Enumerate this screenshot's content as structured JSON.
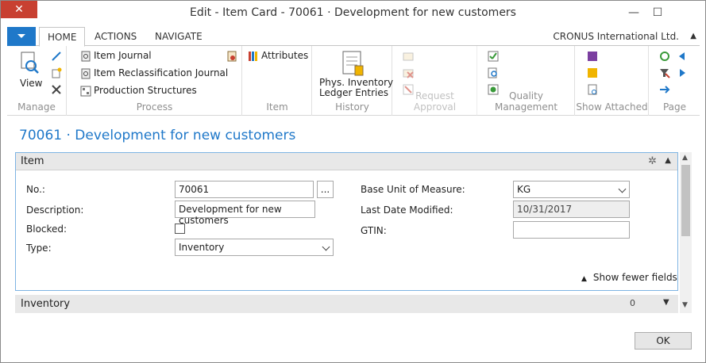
{
  "window": {
    "title": "Edit - Item Card - 70061 · Development for new customers",
    "minimize": "—",
    "maximize": "☐",
    "close": "✕"
  },
  "tabs": {
    "home": "HOME",
    "actions": "ACTIONS",
    "navigate": "NAVIGATE"
  },
  "company": "CRONUS International Ltd.",
  "ribbon": {
    "manage": {
      "label": "Manage",
      "view": "View"
    },
    "process": {
      "label": "Process",
      "item_journal": "Item Journal",
      "item_reclass": "Item Reclassification Journal",
      "prod_structures": "Production Structures"
    },
    "item": {
      "label": "Item",
      "attributes": "Attributes"
    },
    "history": {
      "label": "History",
      "phys_inventory_line1": "Phys. Inventory",
      "phys_inventory_line2": "Ledger Entries"
    },
    "request_approval": {
      "label": "Request Approval"
    },
    "quality_management": {
      "label": "Quality Management"
    },
    "show_attached": {
      "label": "Show Attached"
    },
    "page": {
      "label": "Page"
    }
  },
  "page_title": "70061 · Development for new customers",
  "item_tab": {
    "title": "Item",
    "no_label": "No.:",
    "no_value": "70061",
    "assist": "...",
    "description_label": "Description:",
    "description_value": "Development for new customers",
    "blocked_label": "Blocked:",
    "type_label": "Type:",
    "type_value": "Inventory",
    "base_uom_label": "Base Unit of Measure:",
    "base_uom_value": "KG",
    "last_modified_label": "Last Date Modified:",
    "last_modified_value": "10/31/2017",
    "gtin_label": "GTIN:",
    "gtin_value": "",
    "show_fewer": "Show fewer fields"
  },
  "inventory_tab": {
    "title": "Inventory",
    "value": "0"
  },
  "ok": "OK",
  "colors": {
    "accent": "#1f78c9",
    "close": "#c84031"
  }
}
